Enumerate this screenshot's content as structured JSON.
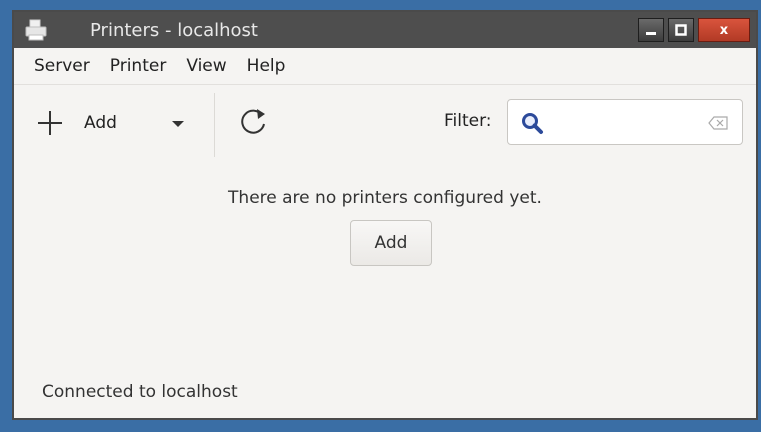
{
  "window": {
    "title": "Printers - localhost"
  },
  "wm_buttons": {
    "close_label": "x"
  },
  "menu": {
    "items": [
      "Server",
      "Printer",
      "View",
      "Help"
    ]
  },
  "toolbar": {
    "add_label": "Add",
    "filter_label": "Filter:",
    "filter_value": "",
    "filter_placeholder": ""
  },
  "main": {
    "empty_message": "There are no printers configured yet.",
    "add_button_label": "Add"
  },
  "statusbar": {
    "text": "Connected to localhost"
  },
  "icons": {
    "app": "printer-icon",
    "add": "plus-icon",
    "dropdown": "chevron-down-icon",
    "refresh": "refresh-icon",
    "search": "search-icon",
    "clear": "clear-text-icon"
  },
  "colors": {
    "titlebar": "#4e4e4e",
    "close_button": "#c8462f",
    "search_icon": "#2c4a9a",
    "window_bg": "#f5f4f2",
    "desktop": "#3a6ea5"
  }
}
